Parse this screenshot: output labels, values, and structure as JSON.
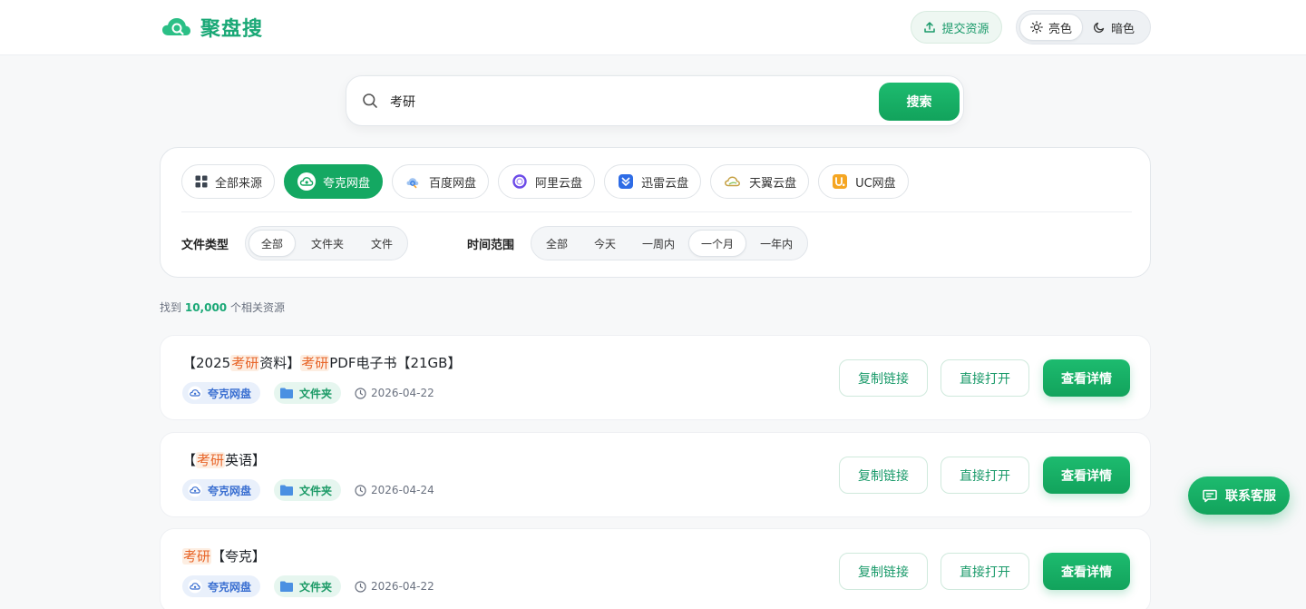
{
  "header": {
    "logo_text": "聚盘搜",
    "submit_label": "提交资源",
    "theme": {
      "light_label": "亮色",
      "dark_label": "暗色",
      "selected": "light"
    }
  },
  "search": {
    "value": "考研",
    "button_label": "搜索"
  },
  "sources": [
    {
      "label": "全部来源",
      "icon": "grid-icon",
      "active": false
    },
    {
      "label": "夸克网盘",
      "icon": "quark-cloud-icon",
      "active": true
    },
    {
      "label": "百度网盘",
      "icon": "baidu-pan-icon",
      "active": false
    },
    {
      "label": "阿里云盘",
      "icon": "aliyun-icon",
      "active": false
    },
    {
      "label": "迅雷云盘",
      "icon": "xunlei-icon",
      "active": false
    },
    {
      "label": "天翼云盘",
      "icon": "tianyi-cloud-icon",
      "active": false
    },
    {
      "label": "UC网盘",
      "icon": "uc-pan-icon",
      "active": false
    }
  ],
  "filters": {
    "file_type": {
      "label": "文件类型",
      "options": [
        "全部",
        "文件夹",
        "文件"
      ],
      "selected": "全部"
    },
    "time_range": {
      "label": "时间范围",
      "options": [
        "全部",
        "今天",
        "一周内",
        "一个月",
        "一年内"
      ],
      "selected": "一个月"
    }
  },
  "results_summary": {
    "prefix": "找到",
    "count": "10,000",
    "suffix": "个相关资源"
  },
  "results": [
    {
      "title_parts": [
        "【2025",
        "考研",
        "资料】",
        "考研",
        "PDF电子书【21GB】"
      ],
      "source_tag": "夸克网盘",
      "type_tag": "文件夹",
      "date": "2026-04-22"
    },
    {
      "title_parts": [
        "【",
        "考研",
        "英语】"
      ],
      "source_tag": "夸克网盘",
      "type_tag": "文件夹",
      "date": "2026-04-24"
    },
    {
      "title_parts": [
        "",
        "考研",
        "【夸克】"
      ],
      "source_tag": "夸克网盘",
      "type_tag": "文件夹",
      "date": "2026-04-22"
    }
  ],
  "result_actions": {
    "copy_label": "复制链接",
    "open_label": "直接打开",
    "detail_label": "查看详情"
  },
  "contact": {
    "label": "联系客服"
  },
  "colors": {
    "brand": "#14a862",
    "highlight": "#e8662a",
    "tag_blue": "#3a6fd1"
  }
}
